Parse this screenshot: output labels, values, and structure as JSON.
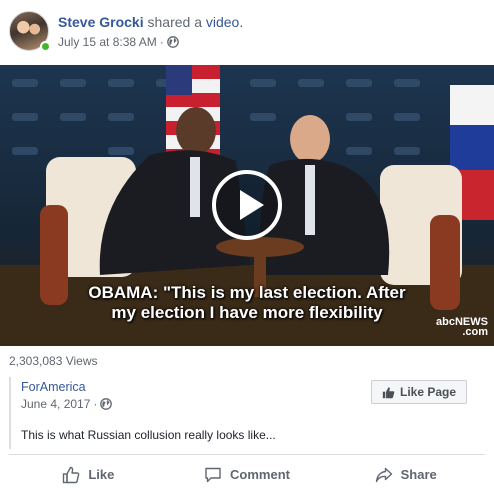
{
  "post": {
    "author": "Steve Grocki",
    "shared_text": "shared a",
    "shared_object": "video.",
    "timestamp": "July 15 at 8:38 AM",
    "separator": "·",
    "privacy_icon": "globe-icon",
    "avatar_online": true
  },
  "video": {
    "subtitle_line1": "OBAMA: \"This is my last election. After",
    "subtitle_line2": "my election I have more flexibility",
    "watermark_line1": "abcNEWS",
    "watermark_line2": ".com",
    "play_icon": "play-icon",
    "colors": {
      "background": "#1c2a3b",
      "chair": "#efe6d8",
      "suit": "#1a1c22"
    }
  },
  "views": "2,303,083 Views",
  "shared_source": {
    "name": "ForAmerica",
    "date": "June 4, 2017",
    "separator": "·",
    "privacy_icon": "globe-icon",
    "text": "This is what Russian collusion really looks like...",
    "like_page_label": "Like Page",
    "like_page_icon": "thumbs-up-icon"
  },
  "actions": [
    {
      "label": "Like",
      "icon": "thumbs-up-icon"
    },
    {
      "label": "Comment",
      "icon": "comment-icon"
    },
    {
      "label": "Share",
      "icon": "share-icon"
    }
  ],
  "colors": {
    "link": "#365899",
    "secondary_text": "#616770",
    "divider": "#dadde1",
    "online": "#42b72a"
  }
}
